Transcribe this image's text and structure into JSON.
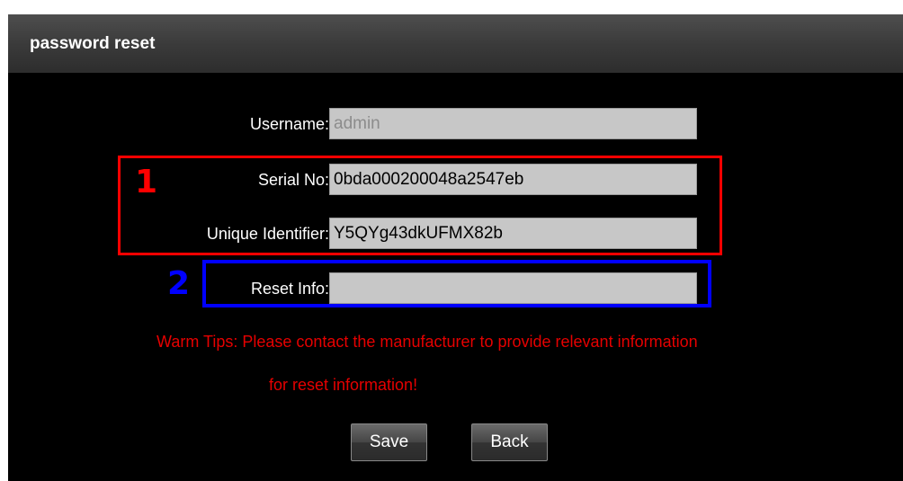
{
  "dialog": {
    "title": "password reset"
  },
  "form": {
    "username": {
      "label": "Username:",
      "value": "admin"
    },
    "serial": {
      "label": "Serial No:",
      "value": "0bda000200048a2547eb"
    },
    "unique_id": {
      "label": "Unique Identifier:",
      "value": "Y5QYg43dkUFMX82b"
    },
    "reset_info": {
      "label": "Reset Info:",
      "value": ""
    }
  },
  "tips": {
    "line1": "Warm Tips: Please contact the manufacturer to provide relevant information",
    "line2": "for reset information!"
  },
  "buttons": {
    "save": "Save",
    "back": "Back"
  },
  "annotations": {
    "box1_number": "1",
    "box2_number": "2",
    "box1_color": "#ff0000",
    "box2_color": "#0000ff"
  }
}
